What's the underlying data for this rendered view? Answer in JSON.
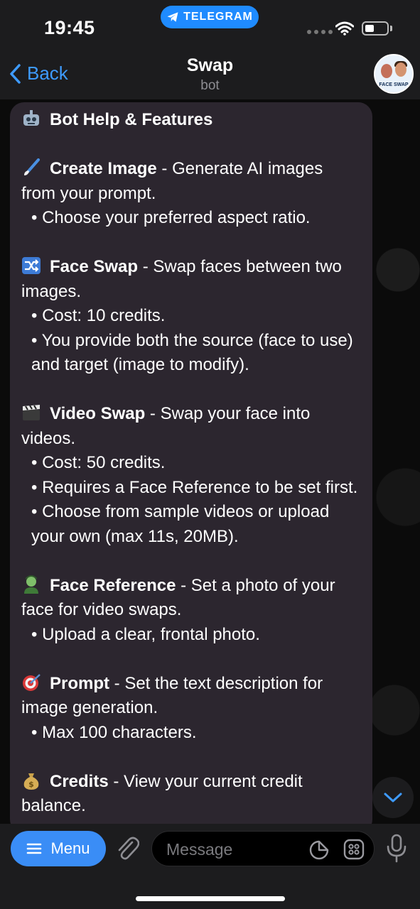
{
  "status_bar": {
    "time": "19:45",
    "app_pill": "TELEGRAM"
  },
  "header": {
    "back_label": "Back",
    "title": "Swap",
    "subtitle": "bot",
    "avatar_text": "FACE SWAP"
  },
  "message": {
    "heading": "Bot Help & Features",
    "sections": [
      {
        "icon": "paintbrush-emoji",
        "title": "Create Image",
        "desc": " - Generate AI images from your prompt.",
        "bullets": [
          "• Choose your preferred aspect ratio."
        ]
      },
      {
        "icon": "shuffle-emoji",
        "title": "Face Swap",
        "desc": " - Swap faces between two images.",
        "bullets": [
          "• Cost: 10 credits.",
          "• You provide both the source (face to use) and target (image to modify)."
        ]
      },
      {
        "icon": "clapper-board-emoji",
        "title": "Video Swap",
        "desc": " - Swap your face into videos.",
        "bullets": [
          "• Cost: 50 credits.",
          "• Requires a Face Reference to be set first.",
          "• Choose from sample videos or upload your own (max 11s, 20MB)."
        ]
      },
      {
        "icon": "zombie-emoji",
        "title": "Face Reference",
        "desc": " - Set a photo of your face for video swaps.",
        "bullets": [
          "• Upload a clear, frontal photo."
        ]
      },
      {
        "icon": "direct-hit-emoji",
        "title": "Prompt",
        "desc": " - Set the text description for image generation.",
        "bullets": [
          "• Max 100 characters."
        ]
      },
      {
        "icon": "money-bag-emoji",
        "title": "Credits",
        "desc": " - View your current credit balance.",
        "bullets": []
      }
    ]
  },
  "input_bar": {
    "menu_label": "Menu",
    "message_placeholder": "Message"
  },
  "colors": {
    "accent": "#3a8df6",
    "bubble": "#2c262f",
    "telegram_pill": "#1f8bff"
  }
}
